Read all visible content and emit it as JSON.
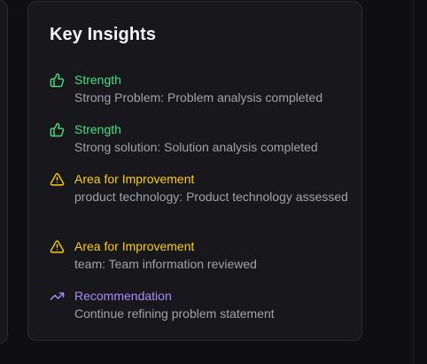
{
  "card": {
    "title": "Key Insights"
  },
  "insights": [
    {
      "type": "strength",
      "icon": "thumbs-up-icon",
      "label": "Strength",
      "description": "Strong Problem: Problem analysis completed"
    },
    {
      "type": "strength",
      "icon": "thumbs-up-icon",
      "label": "Strength",
      "description": "Strong solution: Solution analysis completed"
    },
    {
      "type": "improvement",
      "icon": "warning-triangle-icon",
      "label": "Area for Improvement",
      "description": "product technology: Product technology assessed"
    },
    {
      "type": "improvement",
      "icon": "warning-triangle-icon",
      "label": "Area for Improvement",
      "description": "team: Team information reviewed"
    },
    {
      "type": "recommendation",
      "icon": "trending-up-icon",
      "label": "Recommendation",
      "description": "Continue refining problem statement"
    }
  ],
  "colors": {
    "strength": "#4ade80",
    "improvement": "#facc15",
    "recommendation": "#a78bfa",
    "description": "#a1a1aa",
    "title": "#f4f4f5",
    "card_background": "#18181c",
    "page_background": "#0f0f12"
  }
}
